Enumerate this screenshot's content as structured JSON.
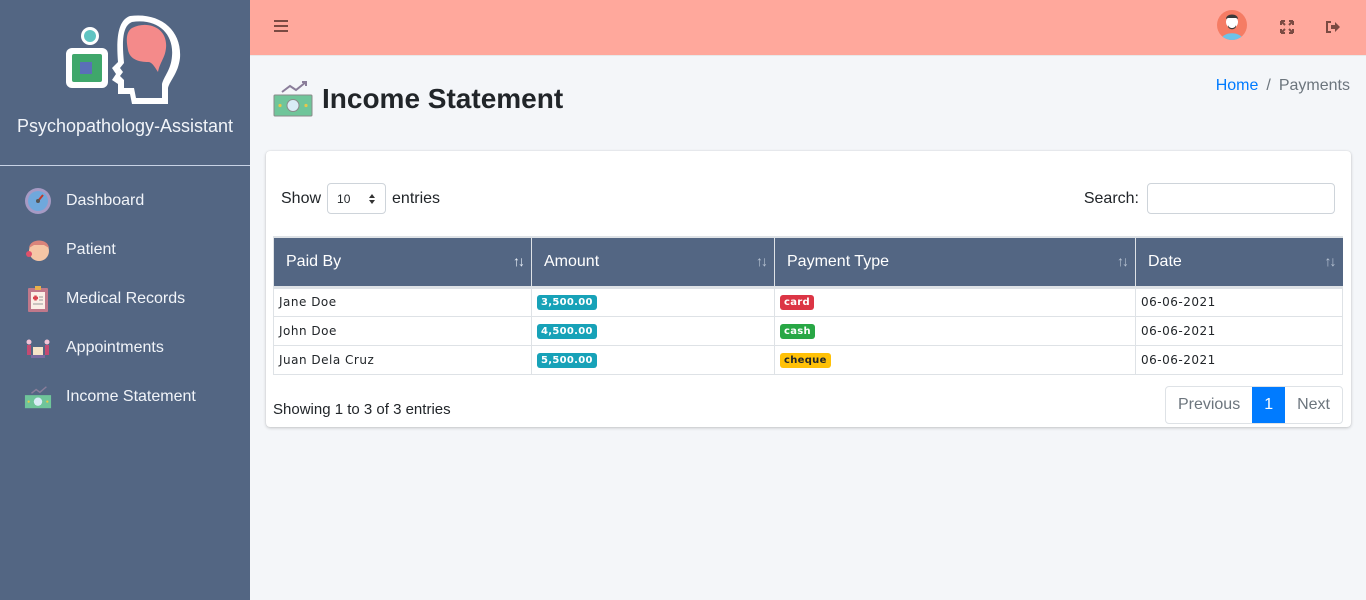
{
  "brand": {
    "name": "Psychopathology-Assistant"
  },
  "sidebar": {
    "items": [
      {
        "label": "Dashboard",
        "icon": "dashboard-gauge-icon"
      },
      {
        "label": "Patient",
        "icon": "patient-icon"
      },
      {
        "label": "Medical Records",
        "icon": "clipboard-icon"
      },
      {
        "label": "Appointments",
        "icon": "appointment-icon"
      },
      {
        "label": "Income Statement",
        "icon": "money-icon"
      }
    ]
  },
  "topbar": {
    "menu_icon": "hamburger-icon",
    "fullscreen_icon": "expand-icon",
    "logout_icon": "sign-out-icon"
  },
  "page": {
    "title": "Income Statement"
  },
  "breadcrumb": {
    "home": "Home",
    "separator": "/",
    "current": "Payments"
  },
  "table_controls": {
    "show_label": "Show",
    "entries_value": "10",
    "entries_label": "entries",
    "search_label": "Search:",
    "search_value": ""
  },
  "table": {
    "headers": [
      "Paid By",
      "Amount",
      "Payment Type",
      "Date"
    ],
    "rows": [
      {
        "paid_by": "Jane Doe",
        "amount": "3,500.00",
        "payment_type": "card",
        "date": "06-06-2021"
      },
      {
        "paid_by": "John Doe",
        "amount": "4,500.00",
        "payment_type": "cash",
        "date": "06-06-2021"
      },
      {
        "paid_by": "Juan Dela Cruz",
        "amount": "5,500.00",
        "payment_type": "cheque",
        "date": "06-06-2021"
      }
    ]
  },
  "colors": {
    "amount": "#17a2b8",
    "card": "#dc3545",
    "cash": "#28a745",
    "cheque": "#ffc107",
    "header": "#536683",
    "topbar": "#ffa89c"
  },
  "footer": {
    "info": "Showing 1 to 3 of 3 entries",
    "previous": "Previous",
    "page": "1",
    "next": "Next"
  }
}
